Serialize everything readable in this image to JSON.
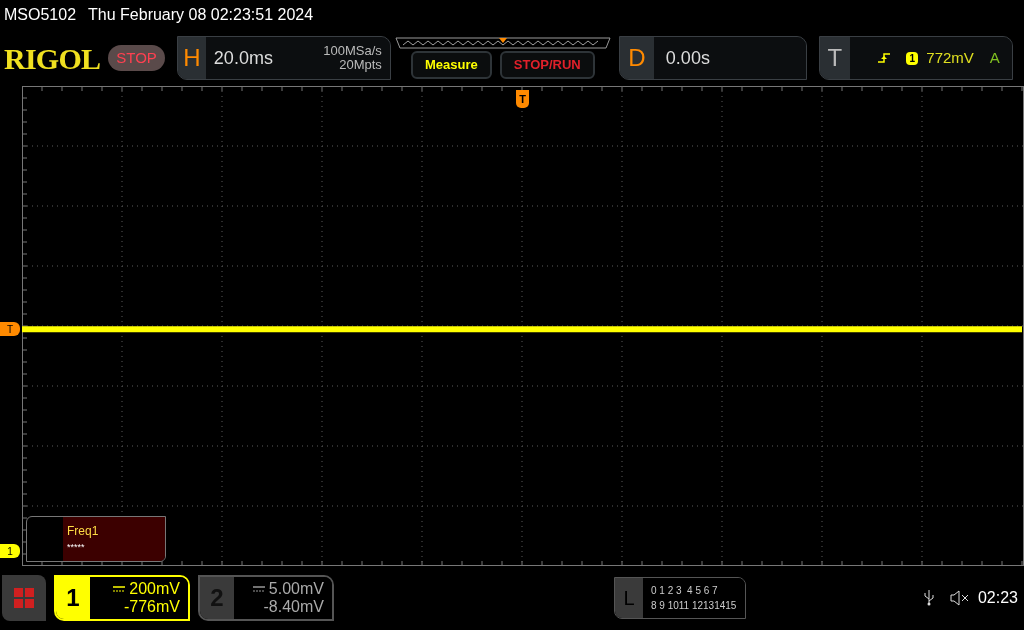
{
  "status_line": {
    "model": "MSO5102",
    "datetime": "Thu February 08 02:23:51 2024"
  },
  "toolbar": {
    "logo": "RIGOL",
    "run_state": "STOP",
    "horizontal": {
      "label": "H",
      "timebase": "20.0ms",
      "sample_rate": "100MSa/s",
      "memory_depth": "20Mpts"
    },
    "buttons": [
      {
        "label": "Measure",
        "kind": "measure"
      },
      {
        "label": "STOP/RUN",
        "kind": "stoprun"
      }
    ],
    "delay": {
      "label": "D",
      "value": "0.00s"
    },
    "trigger": {
      "label": "T",
      "channel": "1",
      "trigger_level": "772mV",
      "mode": "A"
    }
  },
  "display": {
    "trigger_marker": "T",
    "level_marker": "T",
    "channel_marker": "1",
    "measurement": {
      "name": "Freq1",
      "value": "*****"
    }
  },
  "channels": [
    {
      "number": "1",
      "scale": "200mV",
      "offset": "-776mV",
      "selected": true
    },
    {
      "number": "2",
      "scale": "5.00mV",
      "offset": "-8.40mV",
      "selected": false
    }
  ],
  "logic": {
    "label": "L",
    "rows": [
      "0 1 2 3  4 5 6 7",
      "8 9 1011 12131415"
    ]
  },
  "clock": "02:23"
}
